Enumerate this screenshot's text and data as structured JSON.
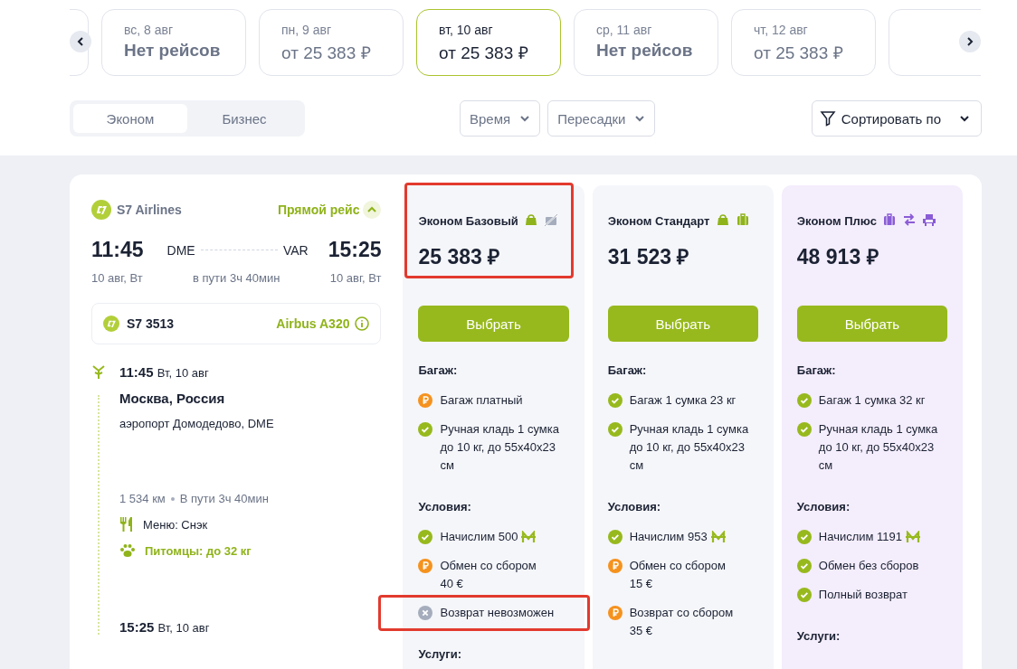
{
  "dates": [
    {
      "day": "вс, 8 авг",
      "price": "Нет рейсов",
      "selected": false,
      "available": false
    },
    {
      "day": "пн, 9 авг",
      "price": "от 25 383 ₽",
      "selected": false,
      "available": true
    },
    {
      "day": "вт, 10 авг",
      "price": "от 25 383 ₽",
      "selected": true,
      "available": true
    },
    {
      "day": "ср, 11 авг",
      "price": "Нет рейсов",
      "selected": false,
      "available": false
    },
    {
      "day": "чт, 12 авг",
      "price": "от 25 383 ₽",
      "selected": false,
      "available": true
    }
  ],
  "cabin_tabs": [
    {
      "label": "Эконом",
      "selected": true
    },
    {
      "label": "Бизнес",
      "selected": false
    }
  ],
  "filters": [
    {
      "label": "Время"
    },
    {
      "label": "Пересадки"
    }
  ],
  "sort": {
    "label": "Сортировать по"
  },
  "flight": {
    "airline": "S7 Airlines",
    "direct_label": "Прямой рейс",
    "expanded": true,
    "departure_time": "11:45",
    "departure_code": "DME",
    "arrival_code": "VAR",
    "arrival_time": "15:25",
    "departure_date": "10 авг, Вт",
    "duration": "в пути 3ч 40мин",
    "arrival_date": "10 авг, Вт",
    "segment": {
      "number": "S7 3513",
      "aircraft": "Airbus A320"
    },
    "timeline": {
      "departure": {
        "time": "11:45",
        "date": "Вт, 10 авг",
        "city": "Москва, Россия",
        "airport": "аэропорт Домодедово, DME"
      },
      "distance": "1 534 км",
      "flight_time": "В пути 3ч 40мин",
      "meal": "Меню: Снэк",
      "pets": "Питомцы: до 32 кг",
      "arrival": {
        "time": "15:25",
        "date": "Вт, 10 авг"
      }
    }
  },
  "tariffs": [
    {
      "name": "Эконом Базовый",
      "color": "#f5f6fa",
      "highlighted": true,
      "icons": [
        {
          "kind": "handbag",
          "color": "#8fb31a"
        },
        {
          "kind": "no-baggage",
          "color": "#a5adbd"
        }
      ],
      "price": "25 383 ₽",
      "button": "Выбрать",
      "sections": [
        {
          "title": "Багаж:",
          "items": [
            {
              "kind": "paid",
              "text": "Багаж платный"
            },
            {
              "kind": "included",
              "text": "Ручная кладь 1 сумка до 10 кг, до 55x40x23 см"
            }
          ]
        },
        {
          "title": "Условия:",
          "items": [
            {
              "kind": "included",
              "text": "Начислим 500",
              "miles": true
            },
            {
              "kind": "paid",
              "text": "Обмен со сбором\n40 €"
            },
            {
              "kind": "unavailable",
              "text": "Возврат невозможен",
              "highlighted": true
            }
          ]
        },
        {
          "title": "Услуги:"
        }
      ]
    },
    {
      "name": "Эконом Стандарт",
      "color": "#f5f6fa",
      "highlighted": false,
      "icons": [
        {
          "kind": "handbag",
          "color": "#8fb31a"
        },
        {
          "kind": "suitcase",
          "color": "#8fb31a"
        }
      ],
      "price": "31 523 ₽",
      "button": "Выбрать",
      "sections": [
        {
          "title": "Багаж:",
          "items": [
            {
              "kind": "included",
              "text": "Багаж 1 сумка 23 кг"
            },
            {
              "kind": "included",
              "text": "Ручная кладь 1 сумка до 10 кг, до 55x40x23 см"
            }
          ]
        },
        {
          "title": "Условия:",
          "items": [
            {
              "kind": "included",
              "text": "Начислим 953",
              "miles": true
            },
            {
              "kind": "paid",
              "text": "Обмен со сбором\n15 €"
            },
            {
              "kind": "paid",
              "text": "Возврат со сбором\n35 €"
            }
          ]
        }
      ]
    },
    {
      "name": "Эконом Плюс",
      "color": "#f4edfc",
      "highlighted": false,
      "icons": [
        {
          "kind": "suitcase",
          "color": "#8a5cd6"
        },
        {
          "kind": "exchange",
          "color": "#8a5cd6"
        },
        {
          "kind": "seat",
          "color": "#8a5cd6"
        }
      ],
      "price": "48 913 ₽",
      "button": "Выбрать",
      "sections": [
        {
          "title": "Багаж:",
          "items": [
            {
              "kind": "included",
              "text": "Багаж 1 сумка 32 кг"
            },
            {
              "kind": "included",
              "text": "Ручная кладь 1 сумка до 10 кг, до 55x40x23 см"
            }
          ]
        },
        {
          "title": "Условия:",
          "items": [
            {
              "kind": "included",
              "text": "Начислим 1191",
              "miles": true
            },
            {
              "kind": "included",
              "text": "Обмен без сборов"
            },
            {
              "kind": "included",
              "text": "Полный возврат"
            }
          ]
        },
        {
          "title": "Услуги:"
        }
      ]
    }
  ]
}
